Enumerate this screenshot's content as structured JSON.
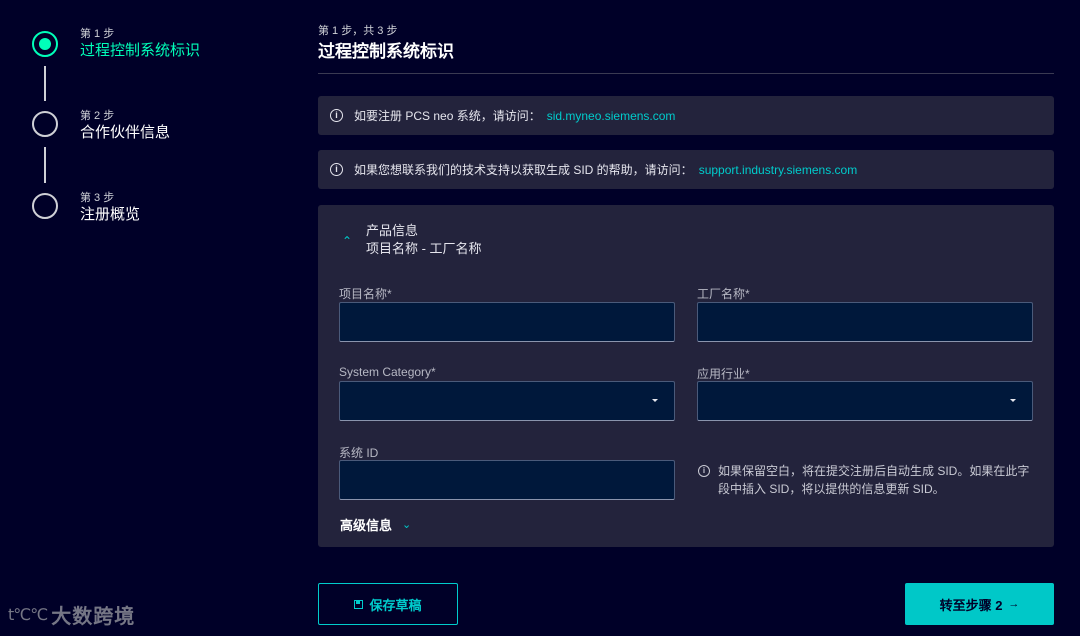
{
  "stepper": {
    "steps": [
      {
        "num": "第 1 步",
        "title": "过程控制系统标识",
        "state": "active"
      },
      {
        "num": "第 2 步",
        "title": "合作伙伴信息",
        "state": "pending"
      },
      {
        "num": "第 3 步",
        "title": "注册概览",
        "state": "pending"
      }
    ]
  },
  "header": {
    "counter": "第 1 步，共 3 步",
    "title": "过程控制系统标识"
  },
  "notices": [
    {
      "text": "如要注册 PCS neo 系统，请访问：",
      "link": "sid.myneo.siemens.com",
      "icon": "info-icon"
    },
    {
      "text": "如果您想联系我们的技术支持以获取生成 SID 的帮助，请访问：",
      "link": "support.industry.siemens.com",
      "icon": "info-icon"
    }
  ],
  "product_section": {
    "title": "产品信息",
    "subtitle": "项目名称 - 工厂名称",
    "expanded": true,
    "fields": {
      "project_name": {
        "label": "项目名称*",
        "value": ""
      },
      "plant_name": {
        "label": "工厂名称*",
        "value": ""
      },
      "system_category": {
        "label": "System Category*",
        "value": ""
      },
      "industry": {
        "label": "应用行业*",
        "value": ""
      },
      "system_id": {
        "label": "系统 ID",
        "value": ""
      }
    },
    "sid_hint": "如果保留空白，将在提交注册后自动生成 SID。如果在此字段中插入 SID，将以提供的信息更新 SID。",
    "advanced_label": "高级信息"
  },
  "footer": {
    "save_draft_label": "保存草稿",
    "next_label": "转至步骤 2"
  },
  "watermark": {
    "mark": "t℃℃",
    "text": "大数跨境"
  },
  "colors": {
    "background": "#000028",
    "panel": "#23233c",
    "accent_green": "#00ffb9",
    "accent_teal": "#00cccc",
    "input_bg": "#00183b"
  }
}
